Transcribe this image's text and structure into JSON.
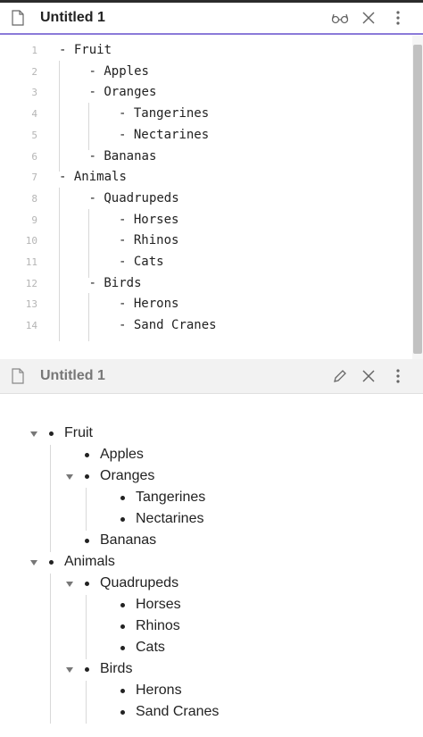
{
  "editor": {
    "title": "Untitled 1",
    "line_numbers": [
      "1",
      "2",
      "3",
      "4",
      "5",
      "6",
      "7",
      "8",
      "9",
      "10",
      "11",
      "12",
      "13",
      "14"
    ],
    "lines": [
      {
        "marker": "-",
        "text": "Fruit",
        "depth": 0
      },
      {
        "marker": "-",
        "text": "Apples",
        "depth": 1
      },
      {
        "marker": "-",
        "text": "Oranges",
        "depth": 1
      },
      {
        "marker": "-",
        "text": "Tangerines",
        "depth": 2
      },
      {
        "marker": "-",
        "text": "Nectarines",
        "depth": 2
      },
      {
        "marker": "-",
        "text": "Bananas",
        "depth": 1
      },
      {
        "marker": "-",
        "text": "Animals",
        "depth": 0
      },
      {
        "marker": "-",
        "text": "Quadrupeds",
        "depth": 1
      },
      {
        "marker": "-",
        "text": "Horses",
        "depth": 2
      },
      {
        "marker": "-",
        "text": "Rhinos",
        "depth": 2
      },
      {
        "marker": "-",
        "text": "Cats",
        "depth": 2
      },
      {
        "marker": "-",
        "text": "Birds",
        "depth": 1
      },
      {
        "marker": "-",
        "text": "Herons",
        "depth": 2
      },
      {
        "marker": "-",
        "text": "Sand Cranes",
        "depth": 2
      }
    ],
    "header_icons": [
      "reading-glasses-icon",
      "close-icon",
      "more-vertical-icon"
    ]
  },
  "preview": {
    "title": "Untitled 1",
    "items": [
      {
        "text": "Fruit",
        "depth": 0,
        "collapsible": true
      },
      {
        "text": "Apples",
        "depth": 1,
        "collapsible": false
      },
      {
        "text": "Oranges",
        "depth": 1,
        "collapsible": true
      },
      {
        "text": "Tangerines",
        "depth": 2,
        "collapsible": false
      },
      {
        "text": "Nectarines",
        "depth": 2,
        "collapsible": false
      },
      {
        "text": "Bananas",
        "depth": 1,
        "collapsible": false
      },
      {
        "text": "Animals",
        "depth": 0,
        "collapsible": true
      },
      {
        "text": "Quadrupeds",
        "depth": 1,
        "collapsible": true
      },
      {
        "text": "Horses",
        "depth": 2,
        "collapsible": false
      },
      {
        "text": "Rhinos",
        "depth": 2,
        "collapsible": false
      },
      {
        "text": "Cats",
        "depth": 2,
        "collapsible": false
      },
      {
        "text": "Birds",
        "depth": 1,
        "collapsible": true
      },
      {
        "text": "Herons",
        "depth": 2,
        "collapsible": false
      },
      {
        "text": "Sand Cranes",
        "depth": 2,
        "collapsible": false
      }
    ],
    "header_icons": [
      "pencil-icon",
      "close-icon",
      "more-vertical-icon"
    ]
  },
  "colors": {
    "accent": "#8b7ad9",
    "text": "#222222",
    "muted": "#b5b5b5"
  }
}
